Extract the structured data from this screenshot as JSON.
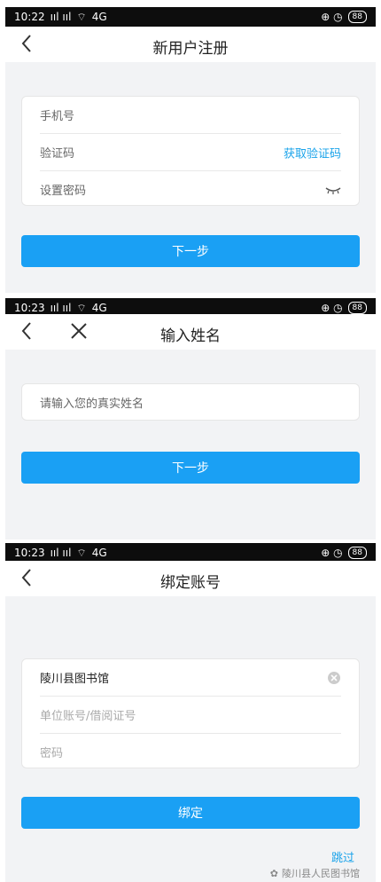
{
  "panel1": {
    "status": {
      "time": "10:22",
      "signal": "ııl ııl",
      "net": "4G",
      "right": "⊕ ◷",
      "battery": "88"
    },
    "title": "新用户注册",
    "fields": [
      {
        "placeholder": "手机号"
      },
      {
        "placeholder": "验证码",
        "action": "获取验证码"
      },
      {
        "placeholder": "设置密码"
      }
    ],
    "next": "下一步"
  },
  "panel2": {
    "status": {
      "time": "10:23",
      "signal": "ııl ııl",
      "net": "4G",
      "right": "⊕ ◷",
      "battery": "88"
    },
    "title": "输入姓名",
    "name_placeholder": "请输入您的真实姓名",
    "next": "下一步"
  },
  "panel3": {
    "status": {
      "time": "10:23",
      "signal": "ııl ııl",
      "net": "4G",
      "right": "⊕ ◷",
      "battery": "88"
    },
    "title": "绑定账号",
    "library": "陵川县图书馆",
    "account_placeholder": "单位账号/借阅证号",
    "password_placeholder": "密码",
    "bind": "绑定",
    "skip": "跳过"
  },
  "watermark": "陵川县人民图书馆",
  "colors": {
    "accent": "#1aa0f4",
    "link": "#1aa3ea",
    "bg": "#f2f3f5"
  }
}
